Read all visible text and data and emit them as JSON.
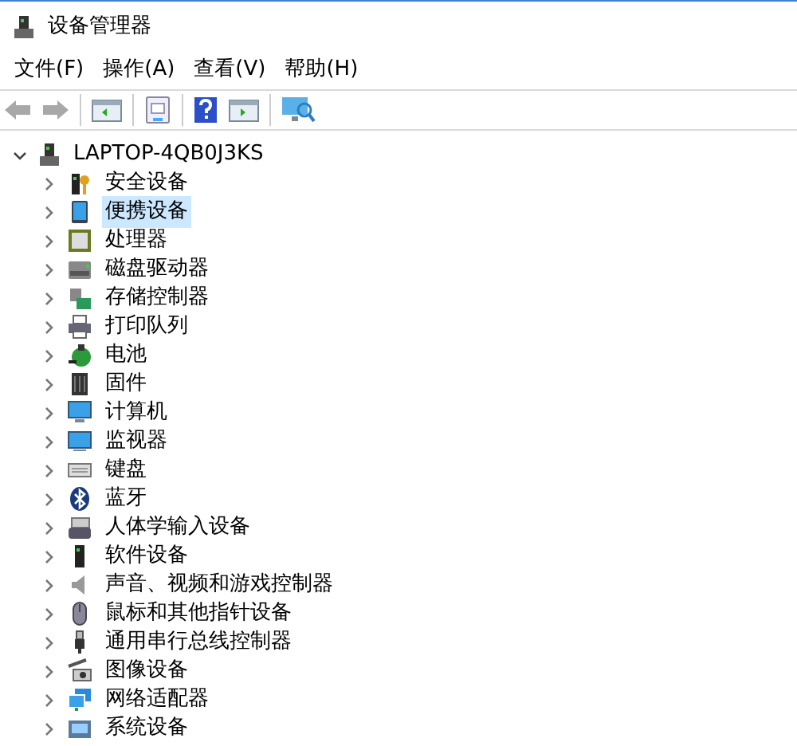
{
  "window": {
    "title": "设备管理器"
  },
  "menu": [
    "文件(F)",
    "操作(A)",
    "查看(V)",
    "帮助(H)"
  ],
  "toolbar": {
    "back_disabled": true,
    "forward_disabled": true
  },
  "tree": {
    "label": "LAPTOP-4QB0J3KS",
    "expanded": true,
    "children": [
      {
        "label": "安全设备",
        "expanded": false,
        "selected": false
      },
      {
        "label": "便携设备",
        "expanded": false,
        "selected": true
      },
      {
        "label": "处理器",
        "expanded": false,
        "selected": false
      },
      {
        "label": "磁盘驱动器",
        "expanded": false,
        "selected": false
      },
      {
        "label": "存储控制器",
        "expanded": false,
        "selected": false
      },
      {
        "label": "打印队列",
        "expanded": false,
        "selected": false
      },
      {
        "label": "电池",
        "expanded": false,
        "selected": false
      },
      {
        "label": "固件",
        "expanded": false,
        "selected": false
      },
      {
        "label": "计算机",
        "expanded": false,
        "selected": false
      },
      {
        "label": "监视器",
        "expanded": false,
        "selected": false
      },
      {
        "label": "键盘",
        "expanded": false,
        "selected": false
      },
      {
        "label": "蓝牙",
        "expanded": false,
        "selected": false
      },
      {
        "label": "人体学输入设备",
        "expanded": false,
        "selected": false
      },
      {
        "label": "软件设备",
        "expanded": false,
        "selected": false
      },
      {
        "label": "声音、视频和游戏控制器",
        "expanded": false,
        "selected": false
      },
      {
        "label": "鼠标和其他指针设备",
        "expanded": false,
        "selected": false
      },
      {
        "label": "通用串行总线控制器",
        "expanded": false,
        "selected": false
      },
      {
        "label": "图像设备",
        "expanded": false,
        "selected": false
      },
      {
        "label": "网络适配器",
        "expanded": false,
        "selected": false
      },
      {
        "label": "系统设备",
        "expanded": false,
        "selected": false
      }
    ]
  }
}
